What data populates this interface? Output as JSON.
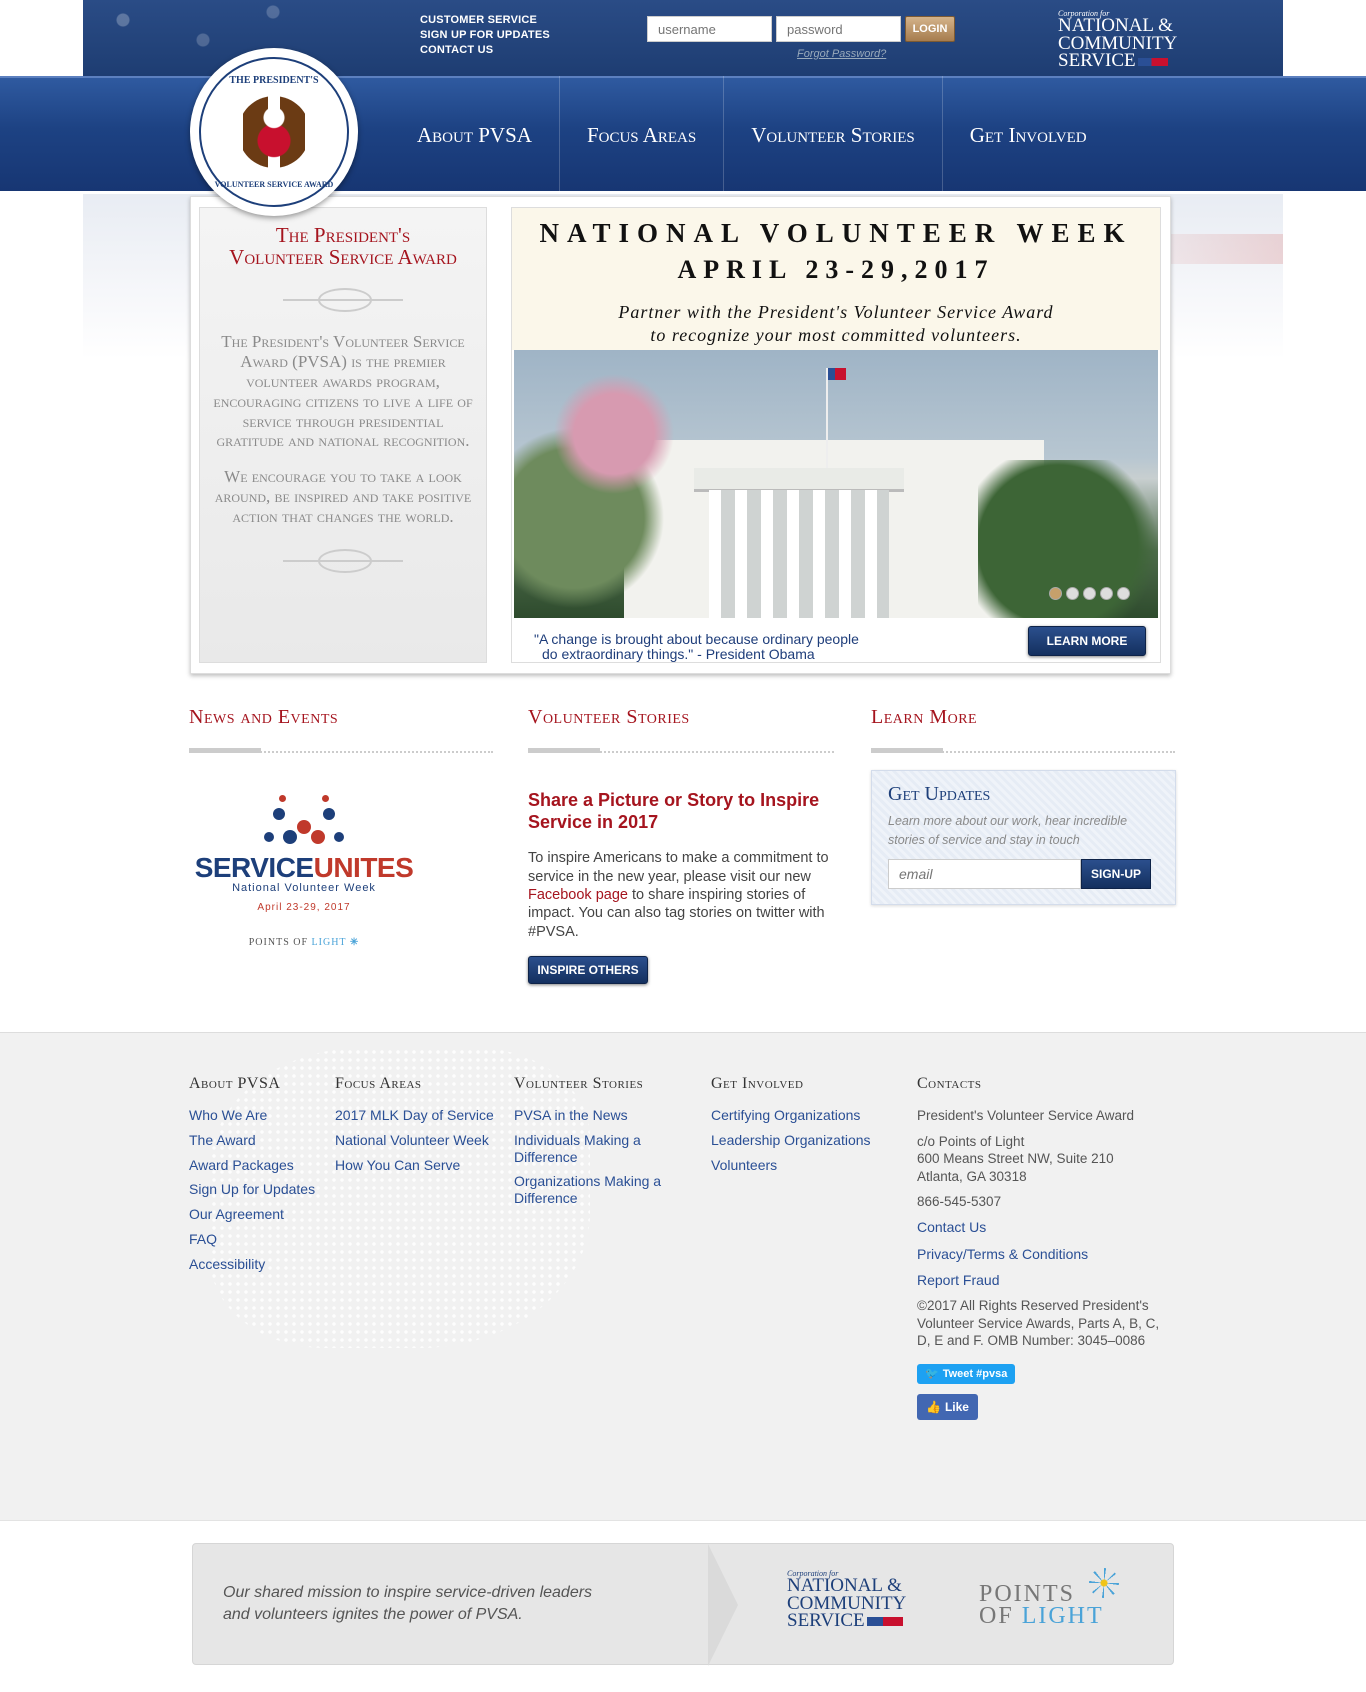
{
  "header": {
    "links": [
      "CUSTOMER SERVICE",
      "SIGN UP FOR UPDATES",
      "CONTACT US"
    ],
    "username_placeholder": "username",
    "password_placeholder": "password",
    "login_label": "LOGIN",
    "forgot_label": "Forgot Password?",
    "cncs_line1": "Corporation for",
    "cncs_line2": "NATIONAL &",
    "cncs_line3": "COMMUNITY",
    "cncs_line4": "SERVICE"
  },
  "seal": {
    "top": "THE PRESIDENT'S",
    "bottom": "VOLUNTEER SERVICE AWARD"
  },
  "nav": {
    "items": [
      "About PVSA",
      "Focus Areas",
      "Volunteer Stories",
      "Get Involved"
    ]
  },
  "intro": {
    "title_line1": "The President's",
    "title_line2": "Volunteer Service Award",
    "para1": "The President's Volunteer Service Award (PVSA) is the premier volunteer awards program, encouraging citizens to live a life of service through presidential gratitude and national recognition.",
    "para2": "We encourage you to take a look around, be inspired and take positive action that changes the world."
  },
  "promo": {
    "title": "NATIONAL VOLUNTEER WEEK",
    "dates": "APRIL 23-29,2017",
    "sub1": "Partner with the President's Volunteer Service Award",
    "sub2": "to recognize your most committed volunteers.",
    "slides": 5,
    "active_slide": 1,
    "quote1": "\"A change is brought about because ordinary people",
    "quote2": "do extraordinary things.\" - President Obama",
    "learn_more": "LEARN MORE"
  },
  "sections": {
    "news": "News and Events",
    "stories": "Volunteer Stories",
    "learn": "Learn More"
  },
  "serviceunites": {
    "word1": "SERVICE",
    "word2": "UNITES",
    "nvw": "National Volunteer Week",
    "dates": "April 23-29, 2017",
    "pol1": "POINTS OF ",
    "pol2": "LIGHT"
  },
  "story": {
    "heading": "Share a Picture or Story to Inspire Service in 2017",
    "text1": "To inspire Americans to make a commitment to service in the new year, please visit our new ",
    "link": "Facebook page",
    "text2": " to share inspiring stories of impact. You can also tag stories on twitter with #PVSA.",
    "button": "INSPIRE OTHERS"
  },
  "updates": {
    "title": "Get Updates",
    "desc": "Learn more about our work, hear incredible stories of service and stay in touch",
    "email_placeholder": "email",
    "button": "SIGN-UP"
  },
  "footer": {
    "about": {
      "title": "About PVSA",
      "links": [
        "Who We Are",
        "The Award",
        "Award Packages",
        "Sign Up for Updates",
        "Our Agreement",
        "FAQ",
        "Accessibility"
      ]
    },
    "focus": {
      "title": "Focus Areas",
      "links": [
        "2017 MLK Day of Service",
        "National Volunteer Week",
        "How You Can Serve"
      ]
    },
    "stories": {
      "title": "Volunteer Stories",
      "links": [
        "PVSA in the News",
        "Individuals Making a Difference",
        "Organizations Making a Difference"
      ]
    },
    "involved": {
      "title": "Get Involved",
      "links": [
        "Certifying Organizations",
        "Leadership Organizations",
        "Volunteers"
      ]
    },
    "contacts": {
      "title": "Contacts",
      "org": "President's Volunteer Service Award",
      "addr1": "c/o Points of Light",
      "addr2": "600 Means Street NW, Suite 210",
      "addr3": "Atlanta, GA  30318",
      "phone": "866-545-5307",
      "contact_us": "Contact Us",
      "privacy": "Privacy/Terms & Conditions",
      "fraud": "Report Fraud",
      "copyright": "©2017 All Rights Reserved President's Volunteer Service Awards, Parts A, B, C, D, E and F. OMB Number: 3045–0086",
      "tweet": "Tweet #pvsa",
      "like": "Like"
    }
  },
  "mission": {
    "line1": "Our shared mission to inspire service-driven leaders",
    "line2": "and volunteers ignites the power of PVSA.",
    "pol1": "POINTS",
    "pol2": "OF ",
    "pol3": "LIGHT"
  }
}
